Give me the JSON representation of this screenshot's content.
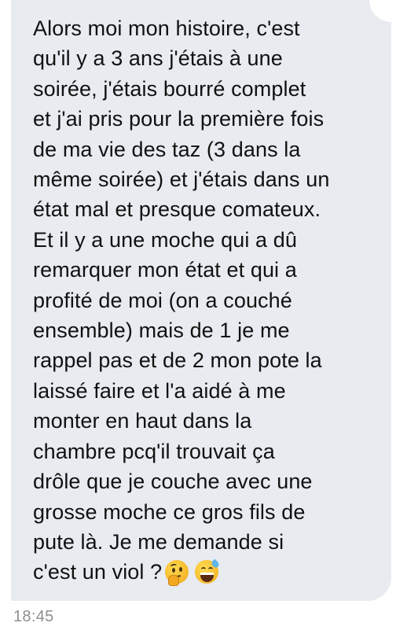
{
  "conversation": {
    "message": {
      "lines": [
        "Alors moi mon histoire, c'est",
        "qu'il y a 3 ans j'étais à une",
        "soirée, j'étais bourré complet",
        "et j'ai pris pour la première fois",
        "de ma vie des taz (3 dans la",
        "même soirée) et j'étais dans un",
        "état mal et  presque comateux.",
        "Et il y a une moche qui a dû",
        "remarquer mon état et qui a",
        "profité de moi (on a couché",
        "ensemble) mais de 1 je me",
        "rappel pas et de 2 mon pote la",
        "laissé faire et l'a aidé à me",
        "monter en haut dans la",
        "chambre pcq'il trouvait ça",
        "drôle que je couche avec une",
        "grosse moche ce gros fils de",
        "pute là. Je me demande si",
        "c'est un viol ?"
      ],
      "emojis": [
        "thinking-face-emoji",
        "grinning-face-with-sweat-emoji"
      ],
      "timestamp": "18:45"
    }
  },
  "colors": {
    "bubble_background": "#e8ebf0",
    "text": "#111111",
    "timestamp": "#8e8e93",
    "page_background": "#ffffff"
  }
}
